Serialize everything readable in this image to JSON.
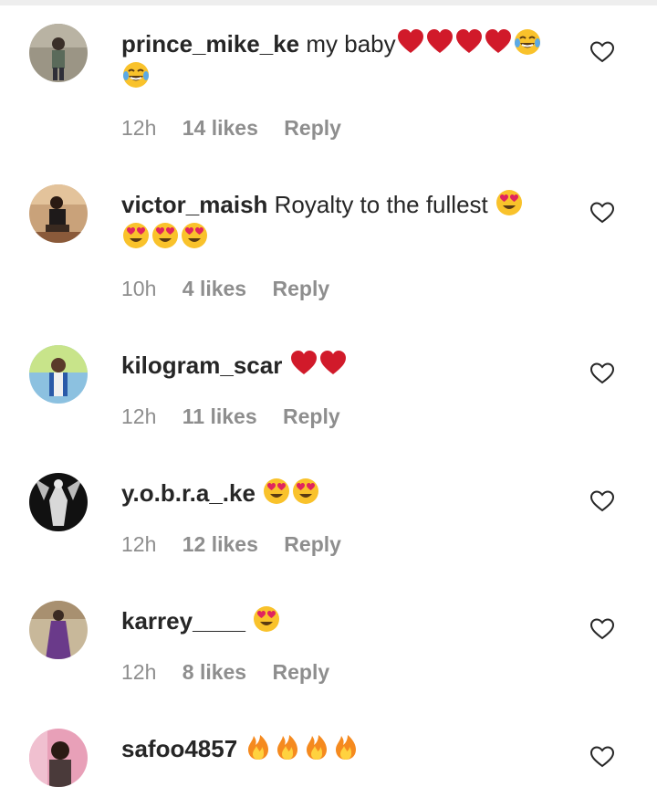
{
  "comments": [
    {
      "username": "prince_mike_ke",
      "text": "my baby",
      "emojis": [
        "heart",
        "heart",
        "heart",
        "heart",
        "laugh",
        "laugh"
      ],
      "time": "12h",
      "likes": "14 likes",
      "reply": "Reply",
      "avatar_color": "#7a7a6a"
    },
    {
      "username": "victor_maish",
      "text": "Royalty to the fullest",
      "emojis": [
        "heart-eyes",
        "heart-eyes",
        "heart-eyes",
        "heart-eyes"
      ],
      "time": "10h",
      "likes": "4 likes",
      "reply": "Reply",
      "avatar_color": "#8a5a3a"
    },
    {
      "username": "kilogram_scar",
      "text": "",
      "emojis": [
        "heart",
        "heart"
      ],
      "time": "12h",
      "likes": "11 likes",
      "reply": "Reply",
      "avatar_color": "#3a6aa8"
    },
    {
      "username": "y.o.b.r.a_.ke",
      "text": "",
      "emojis": [
        "heart-eyes",
        "heart-eyes"
      ],
      "time": "12h",
      "likes": "12 likes",
      "reply": "Reply",
      "avatar_color": "#1a1a1a"
    },
    {
      "username": "karrey____",
      "text": "",
      "emojis": [
        "heart-eyes"
      ],
      "time": "12h",
      "likes": "8 likes",
      "reply": "Reply",
      "avatar_color": "#6a4a7a"
    },
    {
      "username": "safoo4857",
      "text": "",
      "emojis": [
        "fire",
        "fire",
        "fire",
        "fire"
      ],
      "time": "",
      "likes": "",
      "reply": "",
      "avatar_color": "#b86a8a"
    }
  ],
  "colors": {
    "heart_red": "#d11a2a",
    "emoji_yellow": "#f9c22b",
    "tear_blue": "#5aa9e6",
    "fire_orange": "#f58a1f",
    "meta_gray": "#8e8e8e"
  },
  "icons": {
    "like": "heart-outline-icon"
  }
}
